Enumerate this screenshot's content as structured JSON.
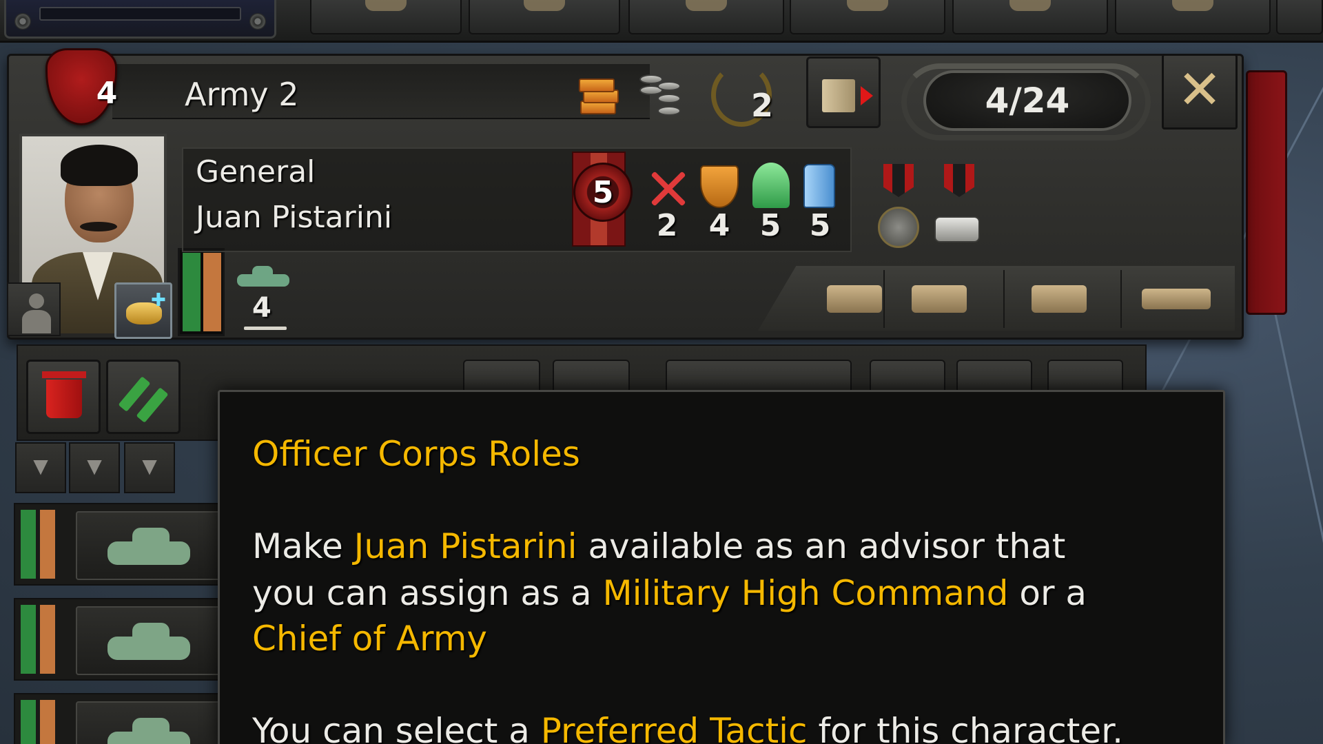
{
  "army": {
    "badge_number": "4",
    "name": "Army 2",
    "laurel_count": "2",
    "division_count": "4/24",
    "close_symbol": "✕"
  },
  "general": {
    "title_line": "General",
    "name_line": "Juan Pistarini",
    "rank": "5",
    "skills": {
      "attack": "2",
      "defense": "4",
      "planning": "5",
      "logistics": "5"
    },
    "tank_count": "4"
  },
  "icons": {
    "supply": "supply-crates-icon",
    "cost": "coins-icon",
    "experience": "laurel-icon",
    "exit": "exit-door-icon",
    "close": "close-icon",
    "attack": "attack-swords-icon",
    "defense": "defense-shield-icon",
    "planning": "planning-knight-icon",
    "logistics": "logistics-fuel-icon",
    "medals": [
      "medal-icon",
      "medal-bar-icon"
    ],
    "unit_types": [
      "stack-icon",
      "infantry-icon",
      "cavalry-icon",
      "air-icon"
    ]
  },
  "filters": [
    "▼",
    "▼",
    "▼"
  ],
  "colors": {
    "highlight": "#f5b800",
    "text": "#ecebe6",
    "org_green": "#2d8a3e",
    "org_orange": "#c4773e"
  },
  "tooltip": {
    "title": "Officer Corps Roles",
    "line1_pre": "Make ",
    "line1_name": "Juan Pistarini",
    "line1_post": " available as an advisor that",
    "line2_pre": "you can assign as a ",
    "line2_role1": "Military High Command",
    "line2_post": " or a",
    "line3_role2": "Chief of Army",
    "line4_pre": "You can select a ",
    "line4_term": "Preferred Tactic",
    "line4_post": " for this character."
  }
}
